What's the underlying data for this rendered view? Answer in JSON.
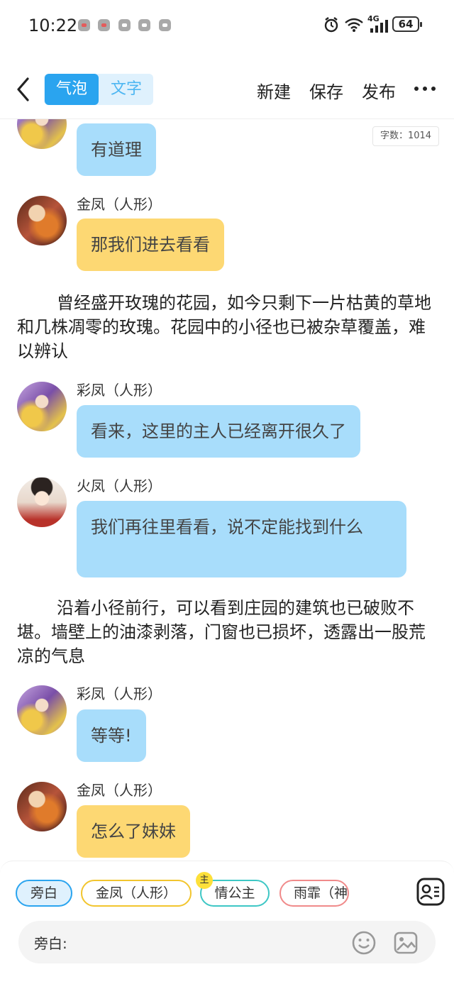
{
  "status_bar": {
    "time": "10:22",
    "network": "4G",
    "battery": "64"
  },
  "header": {
    "mode_bubble": "气泡",
    "mode_text": "文字",
    "new_label": "新建",
    "save_label": "保存",
    "publish_label": "发布"
  },
  "word_count": "字数：1014",
  "messages": [
    {
      "type": "bubble",
      "text": "有道理"
    },
    {
      "type": "bubble",
      "speaker": "金凤（人形）",
      "text": "那我们进去看看"
    },
    {
      "type": "narration",
      "text": "曾经盛开玫瑰的花园，如今只剩下一片枯黄的草地和几株凋零的玫瑰。花园中的小径也已被杂草覆盖，难以辨认"
    },
    {
      "type": "bubble",
      "speaker": "彩凤（人形）",
      "text": "看来，这里的主人已经离开很久了"
    },
    {
      "type": "bubble",
      "speaker": "火凤（人形）",
      "text": "我们再往里看看，说不定能找到什么"
    },
    {
      "type": "narration",
      "text": "沿着小径前行，可以看到庄园的建筑也已破败不堪。墙壁上的油漆剥落，门窗也已损坏，透露出一股荒凉的气息"
    },
    {
      "type": "bubble",
      "speaker": "彩凤（人形）",
      "text": "等等!"
    },
    {
      "type": "bubble",
      "speaker": "金凤（人形）",
      "text": "怎么了妹妹"
    }
  ],
  "characters": [
    "旁白",
    "金凤（人形）",
    "情公主",
    "雨霏（神"
  ],
  "main_badge": "主",
  "input": {
    "prefix": "旁白:",
    "value": ""
  },
  "colors": {
    "accent": "#2aa4ef",
    "bubble_blue": "#a8ddfb",
    "bubble_yellow": "#fdd873"
  },
  "icons": [
    "back-arrow-icon",
    "more-icon",
    "contacts-icon",
    "emoji-icon",
    "image-icon"
  ]
}
